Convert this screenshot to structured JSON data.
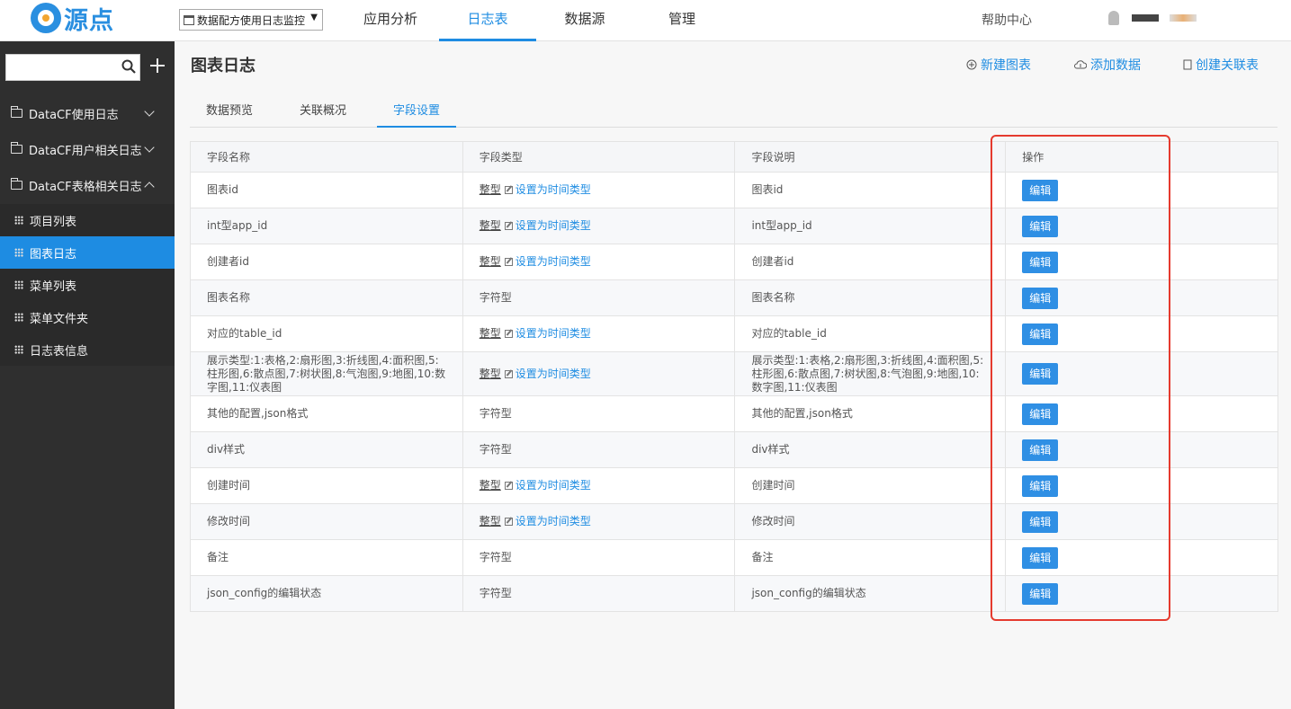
{
  "header": {
    "logo_text": "源点",
    "project_select": "数据配方使用日志监控",
    "nav": [
      "应用分析",
      "日志表",
      "数据源",
      "管理"
    ],
    "active_nav": "日志表",
    "help_label": "帮助中心",
    "user_name": "hidden"
  },
  "sidebar": {
    "search_placeholder": "",
    "folders": [
      {
        "label": "DataCF使用日志",
        "expanded": false
      },
      {
        "label": "DataCF用户相关日志",
        "expanded": false
      },
      {
        "label": "DataCF表格相关日志",
        "expanded": true
      }
    ],
    "items": [
      "项目列表",
      "图表日志",
      "菜单列表",
      "菜单文件夹",
      "日志表信息"
    ],
    "active_item": "图表日志"
  },
  "main": {
    "title": "图表日志",
    "actions": {
      "new_chart": "新建图表",
      "add_data": "添加数据",
      "create_join": "创建关联表"
    },
    "tabs": [
      "数据预览",
      "关联概况",
      "字段设置"
    ],
    "active_tab": "字段设置",
    "table": {
      "headers": [
        "字段名称",
        "字段类型",
        "字段说明",
        "操作"
      ],
      "set_time_label": "设置为时间类型",
      "edit_label": "编辑",
      "rows": [
        {
          "name": "图表id",
          "type": "整型",
          "time_link": true,
          "desc": "图表id"
        },
        {
          "name": "int型app_id",
          "type": "整型",
          "time_link": true,
          "desc": "int型app_id"
        },
        {
          "name": "创建者id",
          "type": "整型",
          "time_link": true,
          "desc": "创建者id"
        },
        {
          "name": "图表名称",
          "type": "字符型",
          "time_link": false,
          "desc": "图表名称"
        },
        {
          "name": "对应的table_id",
          "type": "整型",
          "time_link": true,
          "desc": "对应的table_id"
        },
        {
          "name": "展示类型:1:表格,2:扇形图,3:折线图,4:面积图,5:柱形图,6:散点图,7:树状图,8:气泡图,9:地图,10:数字图,11:仪表图",
          "type": "整型",
          "time_link": true,
          "desc": "展示类型:1:表格,2:扇形图,3:折线图,4:面积图,5:柱形图,6:散点图,7:树状图,8:气泡图,9:地图,10:数字图,11:仪表图"
        },
        {
          "name": "其他的配置,json格式",
          "type": "字符型",
          "time_link": false,
          "desc": "其他的配置,json格式"
        },
        {
          "name": "div样式",
          "type": "字符型",
          "time_link": false,
          "desc": "div样式"
        },
        {
          "name": "创建时间",
          "type": "整型",
          "time_link": true,
          "desc": "创建时间"
        },
        {
          "name": "修改时间",
          "type": "整型",
          "time_link": true,
          "desc": "修改时间"
        },
        {
          "name": "备注",
          "type": "字符型",
          "time_link": false,
          "desc": "备注"
        },
        {
          "name": "json_config的编辑状态",
          "type": "字符型",
          "time_link": false,
          "desc": "json_config的编辑状态"
        }
      ]
    }
  },
  "colors": {
    "accent": "#1e8ce2",
    "sidebar_bg": "#2f2f2f",
    "highlight": "#e53a2e"
  }
}
